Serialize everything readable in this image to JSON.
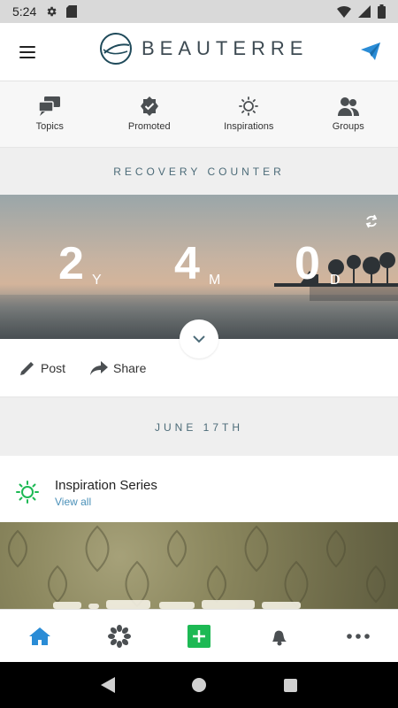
{
  "status_bar": {
    "time": "5:24"
  },
  "header": {
    "logo_text": "BEAUTERRE"
  },
  "category_nav": [
    {
      "label": "Topics",
      "icon": "chat-bubbles-icon"
    },
    {
      "label": "Promoted",
      "icon": "verified-badge-icon"
    },
    {
      "label": "Inspirations",
      "icon": "sun-icon"
    },
    {
      "label": "Groups",
      "icon": "people-icon"
    }
  ],
  "recovery": {
    "section_title": "RECOVERY COUNTER",
    "years": "2",
    "years_unit": "Y",
    "months": "4",
    "months_unit": "M",
    "days": "0",
    "days_unit": "D"
  },
  "actions": {
    "post_label": "Post",
    "share_label": "Share"
  },
  "date_section": {
    "title": "JUNE 17TH"
  },
  "inspiration": {
    "title": "Inspiration Series",
    "link": "View all"
  },
  "colors": {
    "accent": "#2a8cd6",
    "green": "#1db954",
    "header_text": "#3d4a52",
    "section_title": "#4c6b78"
  }
}
